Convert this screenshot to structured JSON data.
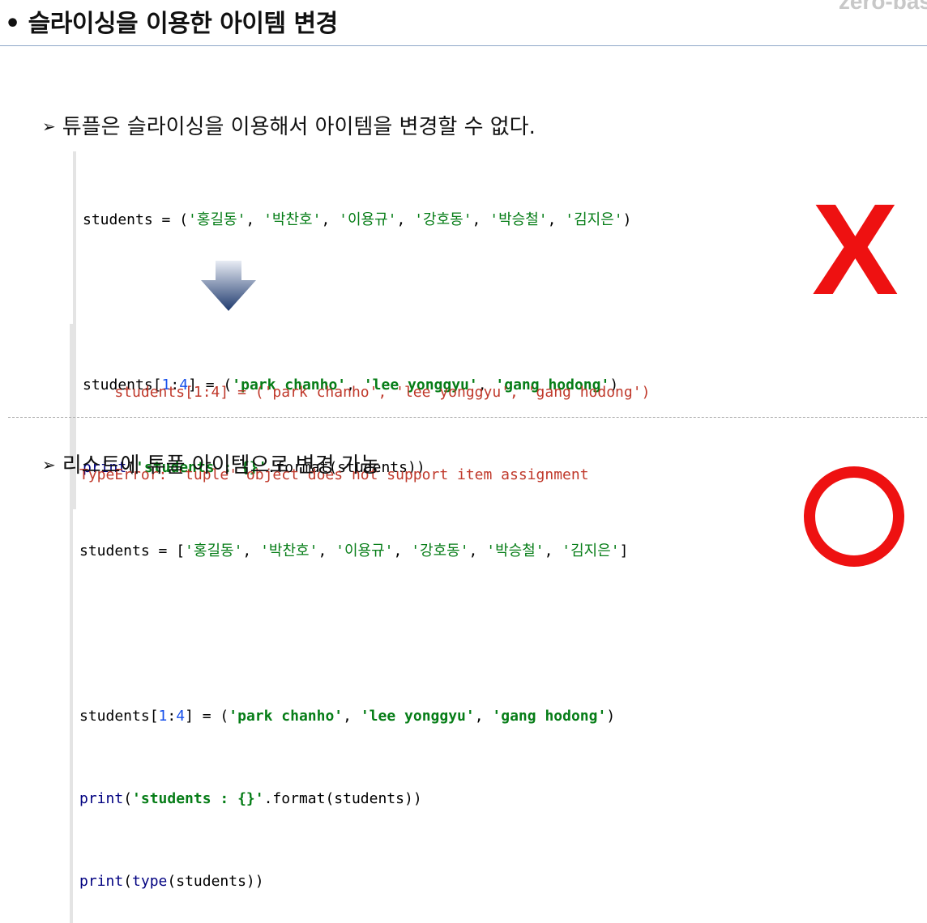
{
  "header": {
    "title": "• 슬라이싱을 이용한 아이템 변경",
    "brand": "zero-bas"
  },
  "section1": {
    "bullet": "튜플은 슬라이싱을 이용해서 아이템을 변경할 수 없다.",
    "code": {
      "l1_a": "students = (",
      "l1_s1": "'홍길동'",
      "l1_s2": "'박찬호'",
      "l1_s3": "'이용규'",
      "l1_s4": "'강호동'",
      "l1_s5": "'박승철'",
      "l1_s6": "'김지은'",
      "sep": ", ",
      "l1_end": ")",
      "l2_a": "students[",
      "l2_n1": "1",
      "l2_colon": ":",
      "l2_n2": "4",
      "l2_b": "] = (",
      "l2_s1": "'park chanho'",
      "l2_s2": "'lee yonggyu'",
      "l2_s3": "'gang hodong'",
      "l2_end": ")",
      "l3_fn": "print",
      "l3_a": "(",
      "l3_s": "'students : {}'",
      "l3_b": ".format(students))"
    },
    "error": {
      "line1": "    students[1:4] = ('park chanho', 'lee yonggyu', 'gang hodong')",
      "line2": "TypeError: 'tuple' object does not support item assignment"
    },
    "mark": "X"
  },
  "section2": {
    "bullet": "리스트에 튜플 아이템으로 변경 가능",
    "code": {
      "l1_a": "students = [",
      "l1_s1": "'홍길동'",
      "l1_s2": "'박찬호'",
      "l1_s3": "'이용규'",
      "l1_s4": "'강호동'",
      "l1_s5": "'박승철'",
      "l1_s6": "'김지은'",
      "sep": ", ",
      "l1_end": "]",
      "l2_a": "students[",
      "l2_n1": "1",
      "l2_colon": ":",
      "l2_n2": "4",
      "l2_b": "] = (",
      "l2_s1": "'park chanho'",
      "l2_s2": "'lee yonggyu'",
      "l2_s3": "'gang hodong'",
      "l2_end": ")",
      "l3_fn": "print",
      "l3_a": "(",
      "l3_s": "'students : {}'",
      "l3_b": ".format(students))",
      "l4_fn1": "print",
      "l4_a": "(",
      "l4_fn2": "type",
      "l4_b": "(students))"
    }
  },
  "colors": {
    "accent_red": "#ee1111",
    "string_green": "#067d17",
    "number_blue": "#1750eb",
    "error_red": "#c0392b",
    "arrow_blue": "#1f3a6e"
  },
  "icons": {
    "wrong": "x-mark-icon",
    "right": "circle-mark-icon",
    "flow": "down-arrow-icon"
  }
}
